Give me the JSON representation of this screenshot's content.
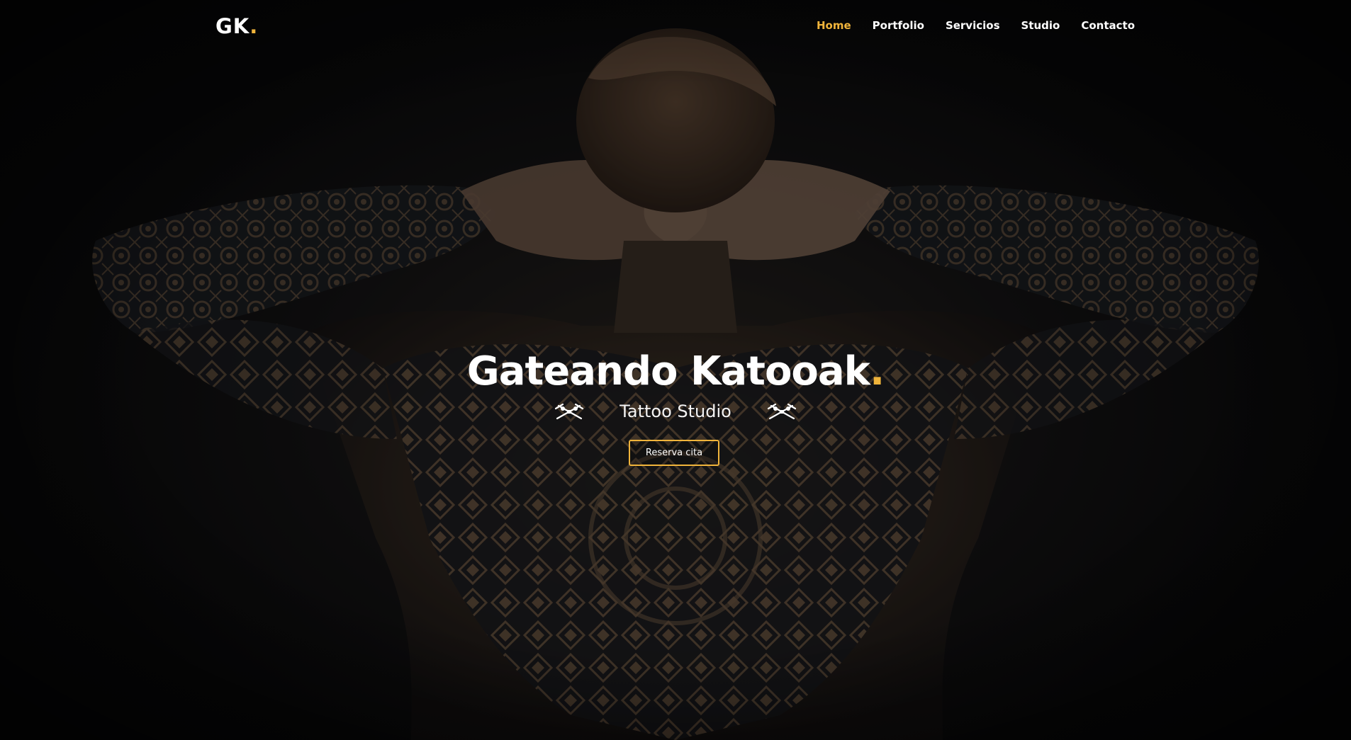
{
  "brand": {
    "logo_text": "GK",
    "logo_dot": ".",
    "accent_color": "#f0b43b"
  },
  "nav": {
    "items": [
      {
        "label": "Home",
        "active": true
      },
      {
        "label": "Portfolio",
        "active": false
      },
      {
        "label": "Servicios",
        "active": false
      },
      {
        "label": "Studio",
        "active": false
      },
      {
        "label": "Contacto",
        "active": false
      }
    ]
  },
  "hero": {
    "title": "Gateando Katooak",
    "title_dot": ".",
    "subtitle": "Tattoo Studio",
    "cta_label": "Reserva cita",
    "left_ornament_icon": "crossed-tattoo-machines-icon",
    "right_ornament_icon": "crossed-tattoo-machines-icon"
  }
}
